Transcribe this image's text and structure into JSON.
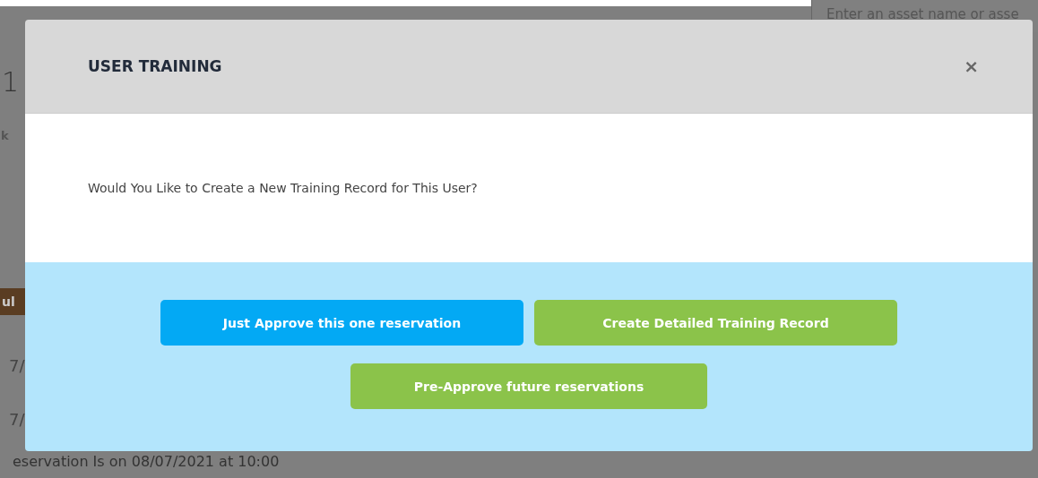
{
  "background": {
    "search": {
      "placeholder": "Enter an asset name or asse"
    },
    "heading_fragment": "1",
    "label_fragment": "k",
    "badge_fragment": "ul",
    "rows": [
      "7/",
      "7/"
    ],
    "footer_text": "eservation Is on 08/07/2021 at 10:00"
  },
  "modal": {
    "title": "USER TRAINING",
    "close": "×",
    "message": "Would You Like to Create a New Training Record for This User?",
    "buttons": [
      {
        "label": "Just Approve this one reservation",
        "kind": "primary"
      },
      {
        "label": "Create Detailed Training Record",
        "kind": "success"
      },
      {
        "label": "Pre-Approve future reservations",
        "kind": "success"
      }
    ]
  }
}
